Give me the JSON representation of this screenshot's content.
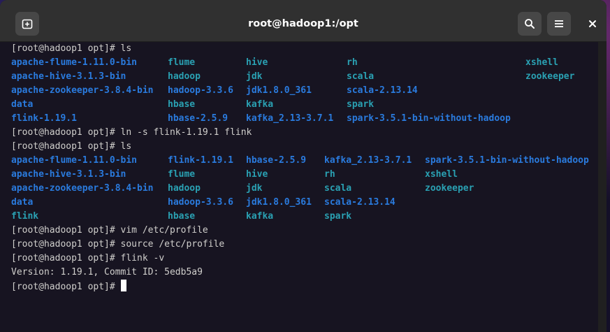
{
  "window": {
    "title": "root@hadoop1:/opt"
  },
  "icons": {
    "new_tab": "new-tab-icon",
    "search": "search-icon",
    "menu": "hamburger-menu-icon",
    "close": "close-icon"
  },
  "colors": {
    "directory": "#2a7bde",
    "symlink": "#2aa1b3",
    "text": "#d0cfcc",
    "background": "#171421"
  },
  "terminal": {
    "cmd1": "[root@hadoop1 opt]# ls",
    "ls1": [
      [
        "apache-flume-1.11.0-bin",
        "flume",
        "hive",
        "rh",
        "xshell"
      ],
      [
        "apache-hive-3.1.3-bin",
        "hadoop",
        "jdk",
        "scala",
        "zookeeper"
      ],
      [
        "apache-zookeeper-3.8.4-bin",
        "hadoop-3.3.6",
        "jdk1.8.0_361",
        "scala-2.13.14",
        ""
      ],
      [
        "data",
        "hbase",
        "kafka",
        "spark",
        ""
      ],
      [
        "flink-1.19.1",
        "hbase-2.5.9",
        "kafka_2.13-3.7.1",
        "spark-3.5.1-bin-without-hadoop",
        ""
      ]
    ],
    "cmd2": "[root@hadoop1 opt]# ln -s flink-1.19.1 flink",
    "cmd3": "[root@hadoop1 opt]# ls",
    "ls2": [
      [
        "apache-flume-1.11.0-bin",
        "flink-1.19.1",
        "hbase-2.5.9",
        "kafka_2.13-3.7.1",
        "spark-3.5.1-bin-without-hadoop"
      ],
      [
        "apache-hive-3.1.3-bin",
        "flume",
        "hive",
        "rh",
        "xshell"
      ],
      [
        "apache-zookeeper-3.8.4-bin",
        "hadoop",
        "jdk",
        "scala",
        "zookeeper"
      ],
      [
        "data",
        "hadoop-3.3.6",
        "jdk1.8.0_361",
        "scala-2.13.14",
        ""
      ],
      [
        "flink",
        "hbase",
        "kafka",
        "spark",
        ""
      ]
    ],
    "cmd4": "[root@hadoop1 opt]# vim /etc/profile",
    "cmd5": "[root@hadoop1 opt]# source /etc/profile",
    "cmd6": "[root@hadoop1 opt]# flink -v",
    "output6": "Version: 1.19.1, Commit ID: 5edb5a9",
    "prompt": "[root@hadoop1 opt]#"
  }
}
